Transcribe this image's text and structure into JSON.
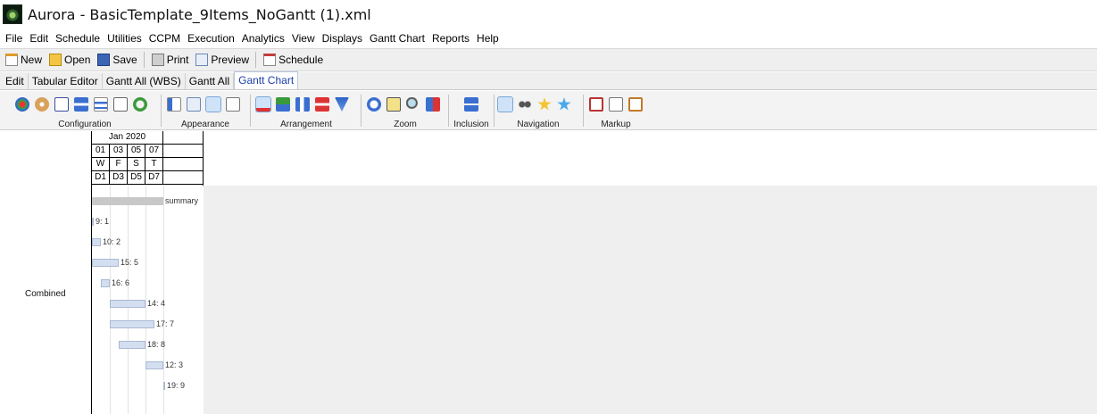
{
  "window": {
    "title": "Aurora - BasicTemplate_9Items_NoGantt (1).xml"
  },
  "menu": [
    "File",
    "Edit",
    "Schedule",
    "Utilities",
    "CCPM",
    "Execution",
    "Analytics",
    "View",
    "Displays",
    "Gantt Chart",
    "Reports",
    "Help"
  ],
  "toolbar": {
    "new": "New",
    "open": "Open",
    "save": "Save",
    "print": "Print",
    "preview": "Preview",
    "schedule": "Schedule"
  },
  "tabs": [
    "Edit",
    "Tabular Editor",
    "Gantt All (WBS)",
    "Gantt All",
    "Gantt Chart"
  ],
  "ribbon": {
    "groups": [
      "Configuration",
      "Appearance",
      "Arrangement",
      "Zoom",
      "Inclusion",
      "Navigation",
      "Markup"
    ]
  },
  "gantt": {
    "row_label": "Combined",
    "month": "Jan 2020",
    "days": [
      "01",
      "03",
      "05",
      "07"
    ],
    "weekdays": [
      "W",
      "F",
      "S",
      "T"
    ],
    "day_codes": [
      "D1",
      "D3",
      "D5",
      "D7"
    ],
    "tasks": [
      {
        "label": "summary",
        "start": 0,
        "duration": 8,
        "summary": true
      },
      {
        "label": "9: 1",
        "start": 0,
        "duration": 0.15
      },
      {
        "label": "10: 2",
        "start": 0,
        "duration": 1
      },
      {
        "label": "15: 5",
        "start": 0,
        "duration": 3
      },
      {
        "label": "16: 6",
        "start": 1,
        "duration": 1
      },
      {
        "label": "14: 4",
        "start": 2,
        "duration": 4
      },
      {
        "label": "17: 7",
        "start": 2,
        "duration": 5
      },
      {
        "label": "18: 8",
        "start": 3,
        "duration": 3
      },
      {
        "label": "12: 3",
        "start": 6,
        "duration": 2
      },
      {
        "label": "19: 9",
        "start": 8,
        "duration": 0.15
      }
    ]
  },
  "colors": {
    "tab_active_text": "#1c3fa8",
    "bar_fill": "#d3dff0",
    "summary_fill": "#c8c8c8",
    "canvas_gray": "#efefef"
  }
}
